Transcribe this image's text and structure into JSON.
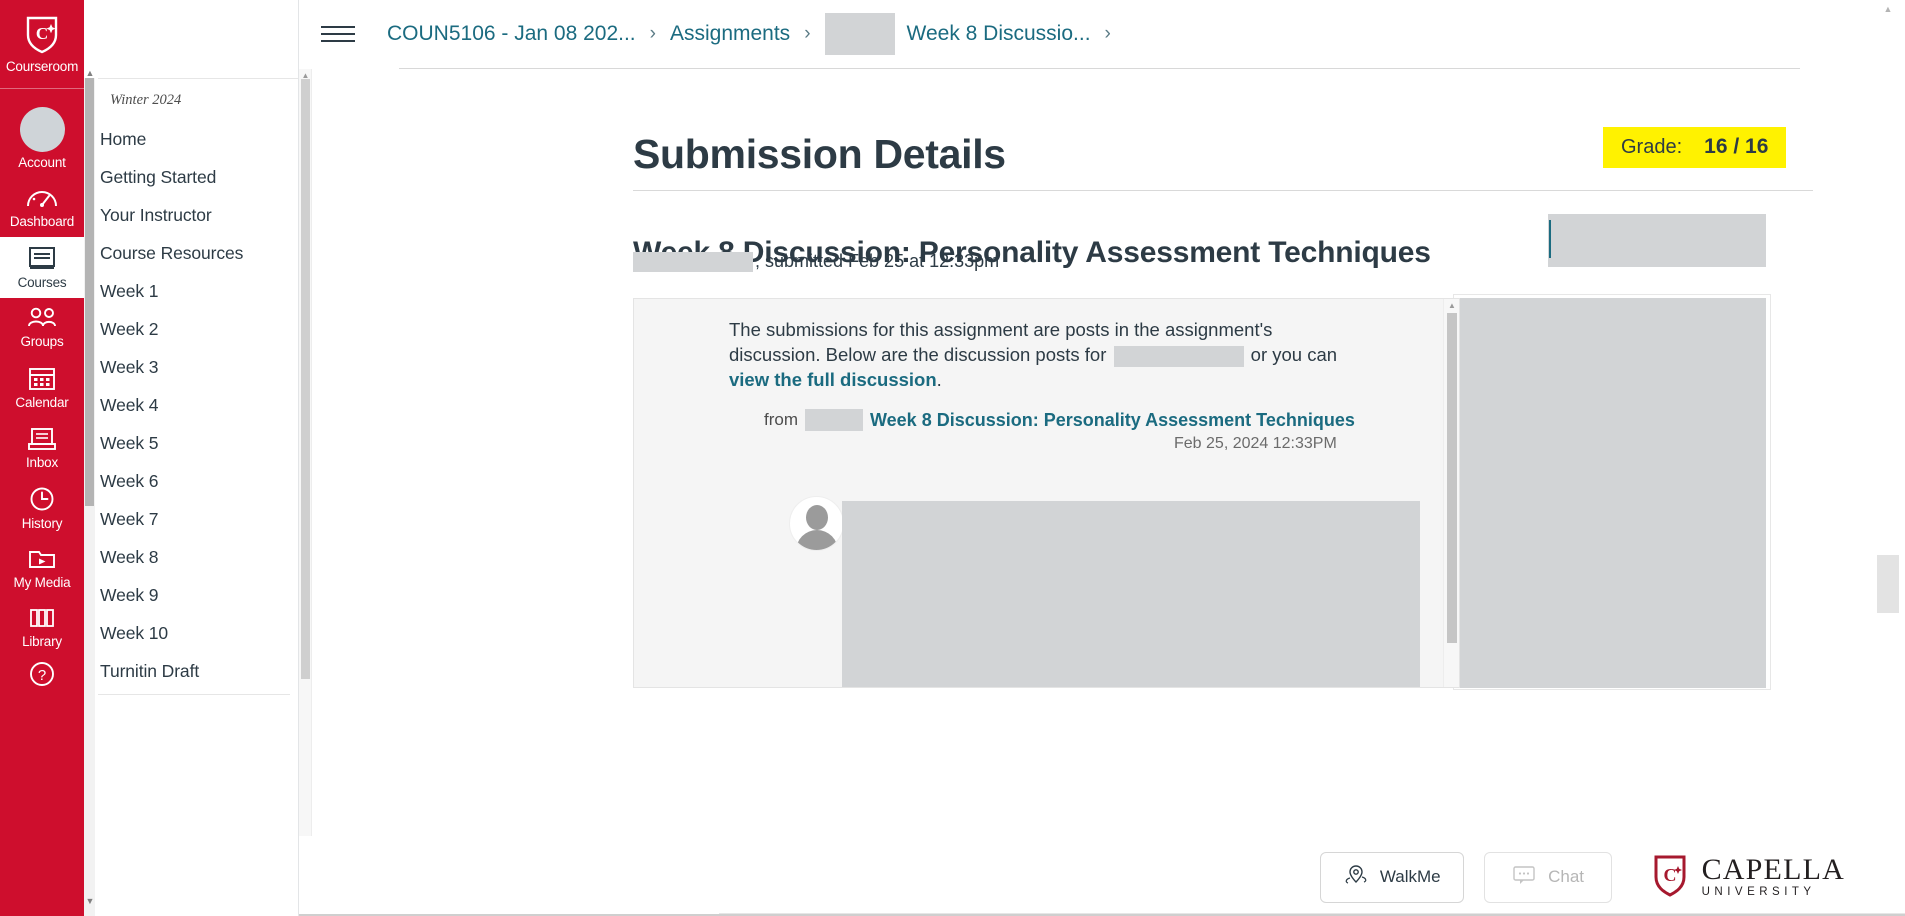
{
  "global_nav": {
    "brand": {
      "label": "Courseroom",
      "icon": "capella-shield-icon"
    },
    "items": [
      {
        "label": "Account",
        "icon": "avatar-icon",
        "active": false
      },
      {
        "label": "Dashboard",
        "icon": "dashboard-gauge-icon",
        "active": false
      },
      {
        "label": "Courses",
        "icon": "courses-book-icon",
        "active": true
      },
      {
        "label": "Groups",
        "icon": "groups-people-icon",
        "active": false
      },
      {
        "label": "Calendar",
        "icon": "calendar-icon",
        "active": false
      },
      {
        "label": "Inbox",
        "icon": "inbox-icon",
        "active": false
      },
      {
        "label": "History",
        "icon": "clock-icon",
        "active": false
      },
      {
        "label": "My Media",
        "icon": "video-folder-icon",
        "active": false
      },
      {
        "label": "Library",
        "icon": "library-books-icon",
        "active": false
      }
    ],
    "help": {
      "icon": "help-question-icon"
    }
  },
  "course_nav": {
    "term": "Winter 2024",
    "items": [
      {
        "label": "Home"
      },
      {
        "label": "Getting Started"
      },
      {
        "label": "Your Instructor"
      },
      {
        "label": "Course Resources"
      },
      {
        "label": "Week 1"
      },
      {
        "label": "Week 2"
      },
      {
        "label": "Week 3"
      },
      {
        "label": "Week 4"
      },
      {
        "label": "Week 5"
      },
      {
        "label": "Week 6"
      },
      {
        "label": "Week 7"
      },
      {
        "label": "Week 8"
      },
      {
        "label": "Week 9"
      },
      {
        "label": "Week 10"
      },
      {
        "label": "Turnitin Draft"
      }
    ]
  },
  "breadcrumb": {
    "menu_icon": "hamburger-menu-icon",
    "course": "COUN5106 - Jan 08 202...",
    "assignments": "Assignments",
    "assignment": "Week 8 Discussio...",
    "separator": "›"
  },
  "page": {
    "title": "Submission Details",
    "grade_label": "Grade:",
    "grade_value": "16 / 16",
    "grade_highlight_color": "#FFF200"
  },
  "submission": {
    "title": "Week 8 Discussion: Personality Assessment Techniques",
    "meta_suffix": "; submitted Feb 25 at 12:33pm"
  },
  "discussion": {
    "intro_part1": "The submissions for this assignment are posts in the assignment's discussion. Below are the discussion posts for",
    "intro_part2": "or you can",
    "intro_link": "view the full discussion",
    "intro_period": ".",
    "from_label": "from",
    "from_link": "Week 8 Discussion: Personality Assessment Techniques",
    "post_date": "Feb 25, 2024 12:33PM",
    "avatar_icon": "default-user-avatar-icon"
  },
  "bottom_bar": {
    "walkme_label": "WalkMe",
    "walkme_icon": "walkme-pin-icon",
    "chat_label": "Chat",
    "chat_icon": "chat-bubble-icon",
    "logo_name": "CAPELLA",
    "logo_sub": "UNIVERSITY",
    "logo_icon": "capella-shield-icon"
  }
}
